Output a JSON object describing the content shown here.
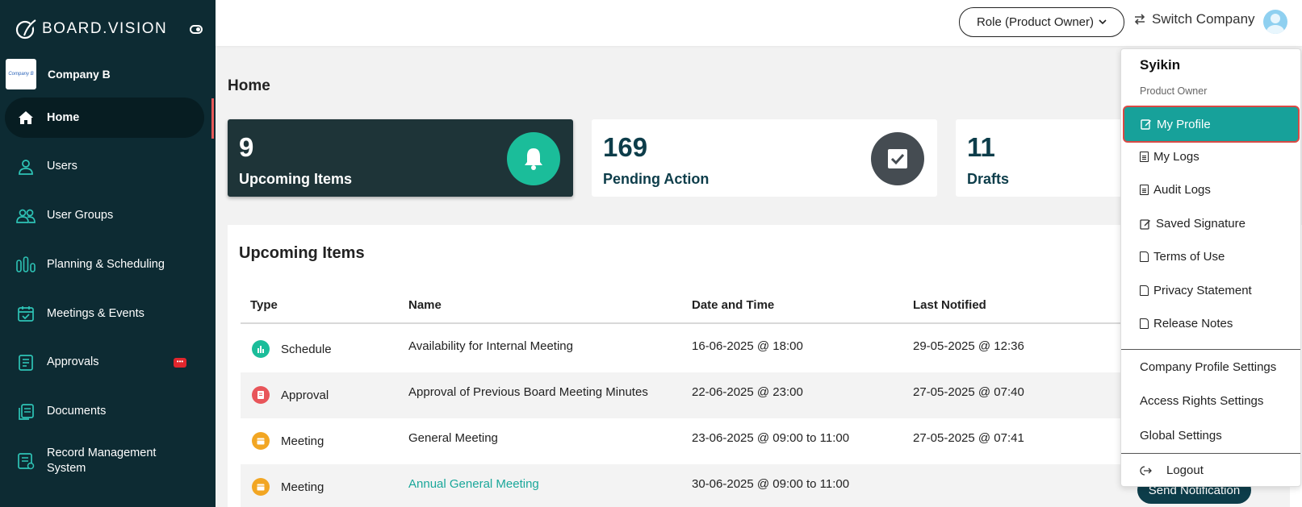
{
  "sidebar": {
    "brand": "BOARD.VISION",
    "company_logo_text": "Company B",
    "company_name": "Company B",
    "items": [
      {
        "label": "Home",
        "icon": "home-icon"
      },
      {
        "label": "Users",
        "icon": "user-icon"
      },
      {
        "label": "User Groups",
        "icon": "users-icon"
      },
      {
        "label": "Planning & Scheduling",
        "icon": "bars-icon"
      },
      {
        "label": "Meetings & Events",
        "icon": "calendar-icon"
      },
      {
        "label": "Approvals",
        "icon": "approval-icon"
      },
      {
        "label": "Documents",
        "icon": "documents-icon"
      },
      {
        "label": "Record Management System",
        "icon": "records-icon"
      }
    ],
    "approvals_badge": "•••"
  },
  "topbar": {
    "role": "Role (Product Owner)",
    "switch_company": "Switch Company"
  },
  "main": {
    "title": "Home",
    "cards": [
      {
        "value": "9",
        "title": "Upcoming Items"
      },
      {
        "value": "169",
        "title": "Pending Action"
      },
      {
        "value": "11",
        "title": "Drafts"
      }
    ],
    "panel_title": "Upcoming Items",
    "columns": [
      "Type",
      "Name",
      "Date and Time",
      "Last Notified"
    ],
    "rows": [
      {
        "type": "Schedule",
        "name": "Availability for Internal Meeting",
        "datetime": "16-06-2025 @ 18:00",
        "notified": "29-05-2025 @ 12:36"
      },
      {
        "type": "Approval",
        "name": "Approval of Previous Board Meeting Minutes",
        "datetime": "22-06-2025 @ 23:00",
        "notified": "27-05-2025 @ 07:40"
      },
      {
        "type": "Meeting",
        "name": "General Meeting",
        "datetime": "23-06-2025 @ 09:00 to 11:00",
        "notified": "27-05-2025 @ 07:41"
      },
      {
        "type": "Meeting",
        "name": "Annual General Meeting",
        "datetime": "30-06-2025 @ 09:00 to 11:00",
        "notified": ""
      }
    ],
    "send_notification": "Send Notification"
  },
  "dropdown": {
    "user": "Syikin",
    "role": "Product Owner",
    "items": [
      "My Profile",
      "My Logs",
      "Audit Logs",
      "Saved Signature",
      "Terms of Use",
      "Privacy Statement",
      "Release Notes"
    ],
    "settings": [
      "Company Profile Settings",
      "Access Rights Settings",
      "Global Settings"
    ],
    "logout": "Logout"
  },
  "colors": {
    "sidebar": "#0d2b33",
    "accent": "#17a19a",
    "highlight_border": "#d84a45",
    "dark_card": "#1e3438"
  }
}
